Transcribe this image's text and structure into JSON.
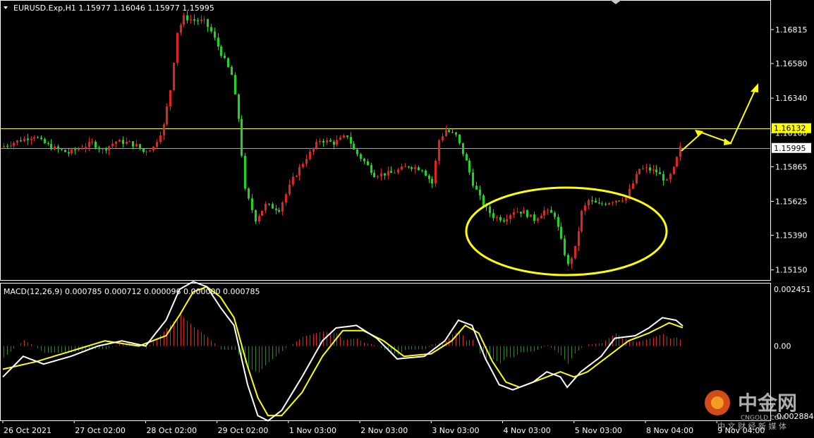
{
  "header": {
    "symbol_line": "EURUSD.Exp,H1  1.15977 1.16046 1.15977 1.15995"
  },
  "indicator": {
    "label": "MACD(12,26,9) 0.000785 0.000712 0.000096 0.000000 0.000785"
  },
  "watermark": {
    "brand": "中金网",
    "domain": "CNGOLD.COM",
    "slogan": "中 文 财 经 新 媒 体"
  },
  "colors": {
    "background": "#000000",
    "bull_candle": "#e32222",
    "bear_candle": "#19d91e",
    "hline_resistance": "#ffff00",
    "hline_price": "#a5a5a5",
    "price_tag_resistance_bg": "#ffff00",
    "price_tag_current_bg": "#ffffff",
    "macd_line": "#ffffff",
    "signal_line": "#ffff00",
    "hist_positive": "#e32222",
    "hist_negative": "#1c8a1c",
    "annotation": "#ffff00",
    "frame": "#ffffff"
  },
  "chart_data": [
    {
      "type": "candlestick",
      "title": "EURUSD.Exp,H1",
      "ylim": [
        1.1508,
        1.1702
      ],
      "y_ticks": [
        "1.16815",
        "1.16580",
        "1.16340",
        "1.16100",
        "1.15865",
        "1.15625",
        "1.15390",
        "1.15150"
      ],
      "x_ticks": [
        "26 Oct 2021",
        "27 Oct 02:00",
        "28 Oct 02:00",
        "29 Oct 02:00",
        "1 Nov 03:00",
        "2 Nov 03:00",
        "3 Nov 03:00",
        "4 Nov 03:00",
        "5 Nov 03:00",
        "8 Nov 04:00",
        "9 Nov 04:00"
      ],
      "horizontal_lines": [
        {
          "value": 1.16132,
          "label": "1.16132",
          "style": "resistance"
        },
        {
          "value": 1.15995,
          "label": "1.15995",
          "style": "current"
        }
      ],
      "close_path": [
        [
          0,
          1.16
        ],
        [
          6,
          1.1605
        ],
        [
          10,
          1.1608
        ],
        [
          12,
          1.1604
        ],
        [
          15,
          1.16
        ],
        [
          20,
          1.1596
        ],
        [
          27,
          1.1603
        ],
        [
          30,
          1.1598
        ],
        [
          34,
          1.1604
        ],
        [
          38,
          1.1603
        ],
        [
          40,
          1.1601
        ],
        [
          42,
          1.1597
        ],
        [
          45,
          1.16
        ],
        [
          48,
          1.1615
        ],
        [
          50,
          1.164
        ],
        [
          52,
          1.168
        ],
        [
          54,
          1.169
        ],
        [
          57,
          1.1688
        ],
        [
          60,
          1.1687
        ],
        [
          62,
          1.168
        ],
        [
          65,
          1.1665
        ],
        [
          68,
          1.165
        ],
        [
          70,
          1.162
        ],
        [
          72,
          1.157
        ],
        [
          75,
          1.155
        ],
        [
          78,
          1.156
        ],
        [
          82,
          1.1557
        ],
        [
          86,
          1.1578
        ],
        [
          90,
          1.1593
        ],
        [
          94,
          1.1605
        ],
        [
          98,
          1.1603
        ],
        [
          102,
          1.1608
        ],
        [
          104,
          1.1598
        ],
        [
          107,
          1.159
        ],
        [
          110,
          1.1581
        ],
        [
          115,
          1.1582
        ],
        [
          120,
          1.1587
        ],
        [
          124,
          1.1585
        ],
        [
          127,
          1.1575
        ],
        [
          129,
          1.1605
        ],
        [
          131,
          1.1612
        ],
        [
          134,
          1.1608
        ],
        [
          137,
          1.159
        ],
        [
          139,
          1.1575
        ],
        [
          142,
          1.156
        ],
        [
          145,
          1.1552
        ],
        [
          148,
          1.155
        ],
        [
          151,
          1.1556
        ],
        [
          154,
          1.1555
        ],
        [
          157,
          1.155
        ],
        [
          160,
          1.1556
        ],
        [
          163,
          1.1553
        ],
        [
          165,
          1.1535
        ],
        [
          167,
          1.1518
        ],
        [
          169,
          1.153
        ],
        [
          171,
          1.1555
        ],
        [
          173,
          1.1563
        ],
        [
          176,
          1.156
        ],
        [
          180,
          1.1563
        ],
        [
          184,
          1.1565
        ],
        [
          186,
          1.1575
        ],
        [
          188,
          1.1585
        ],
        [
          190,
          1.1585
        ],
        [
          193,
          1.1583
        ],
        [
          196,
          1.1576
        ],
        [
          198,
          1.1585
        ],
        [
          200,
          1.15995
        ]
      ],
      "annotations": [
        {
          "type": "ellipse",
          "shape": "highlights 4–8 Nov consolidation low area"
        },
        {
          "type": "arrow-path",
          "shape": "projected zigzag continuation upward"
        }
      ]
    },
    {
      "type": "macd",
      "name": "MACD(12,26,9)",
      "ylim": [
        -0.002884,
        0.002451
      ],
      "y_ticks": [
        "0.002451",
        "0.00",
        "-0.002884"
      ],
      "macd_path": [
        [
          0,
          -0.0012
        ],
        [
          6,
          -0.0004
        ],
        [
          12,
          -0.0007
        ],
        [
          20,
          -0.0004
        ],
        [
          28,
          0.0
        ],
        [
          35,
          0.0002
        ],
        [
          42,
          0.0
        ],
        [
          48,
          0.001
        ],
        [
          52,
          0.0022
        ],
        [
          56,
          0.0025
        ],
        [
          60,
          0.0023
        ],
        [
          64,
          0.0015
        ],
        [
          68,
          0.0008
        ],
        [
          72,
          -0.0015
        ],
        [
          75,
          -0.0027
        ],
        [
          78,
          -0.0029
        ],
        [
          82,
          -0.0025
        ],
        [
          88,
          -0.0012
        ],
        [
          94,
          0.0002
        ],
        [
          98,
          0.0007
        ],
        [
          104,
          0.0008
        ],
        [
          110,
          0.0003
        ],
        [
          116,
          -0.0005
        ],
        [
          124,
          -0.0004
        ],
        [
          130,
          0.0002
        ],
        [
          134,
          0.001
        ],
        [
          138,
          0.0008
        ],
        [
          142,
          -0.0005
        ],
        [
          146,
          -0.0015
        ],
        [
          150,
          -0.0017
        ],
        [
          156,
          -0.0014
        ],
        [
          160,
          -0.001
        ],
        [
          164,
          -0.0012
        ],
        [
          166,
          -0.0016
        ],
        [
          170,
          -0.001
        ],
        [
          176,
          -0.0004
        ],
        [
          180,
          0.0003
        ],
        [
          186,
          0.0004
        ],
        [
          190,
          0.0007
        ],
        [
          194,
          0.0011
        ],
        [
          198,
          0.001
        ],
        [
          200,
          0.00078
        ]
      ],
      "signal_path": [
        [
          0,
          -0.0009
        ],
        [
          10,
          -0.0006
        ],
        [
          20,
          -0.0002
        ],
        [
          30,
          0.0002
        ],
        [
          40,
          0.0
        ],
        [
          48,
          0.0004
        ],
        [
          52,
          0.0012
        ],
        [
          56,
          0.0021
        ],
        [
          60,
          0.0023
        ],
        [
          64,
          0.0019
        ],
        [
          68,
          0.0011
        ],
        [
          72,
          -0.0008
        ],
        [
          75,
          -0.002
        ],
        [
          78,
          -0.0027
        ],
        [
          82,
          -0.0027
        ],
        [
          88,
          -0.0018
        ],
        [
          94,
          -0.0004
        ],
        [
          100,
          0.0006
        ],
        [
          106,
          0.0006
        ],
        [
          112,
          0.0002
        ],
        [
          118,
          -0.0004
        ],
        [
          126,
          -0.0003
        ],
        [
          132,
          0.0002
        ],
        [
          136,
          0.0008
        ],
        [
          140,
          0.0005
        ],
        [
          144,
          -0.0006
        ],
        [
          148,
          -0.0014
        ],
        [
          152,
          -0.0016
        ],
        [
          158,
          -0.0013
        ],
        [
          164,
          -0.001
        ],
        [
          168,
          -0.0012
        ],
        [
          172,
          -0.001
        ],
        [
          178,
          -0.0004
        ],
        [
          184,
          0.0002
        ],
        [
          190,
          0.0005
        ],
        [
          196,
          0.0009
        ],
        [
          200,
          0.00071
        ]
      ]
    }
  ]
}
